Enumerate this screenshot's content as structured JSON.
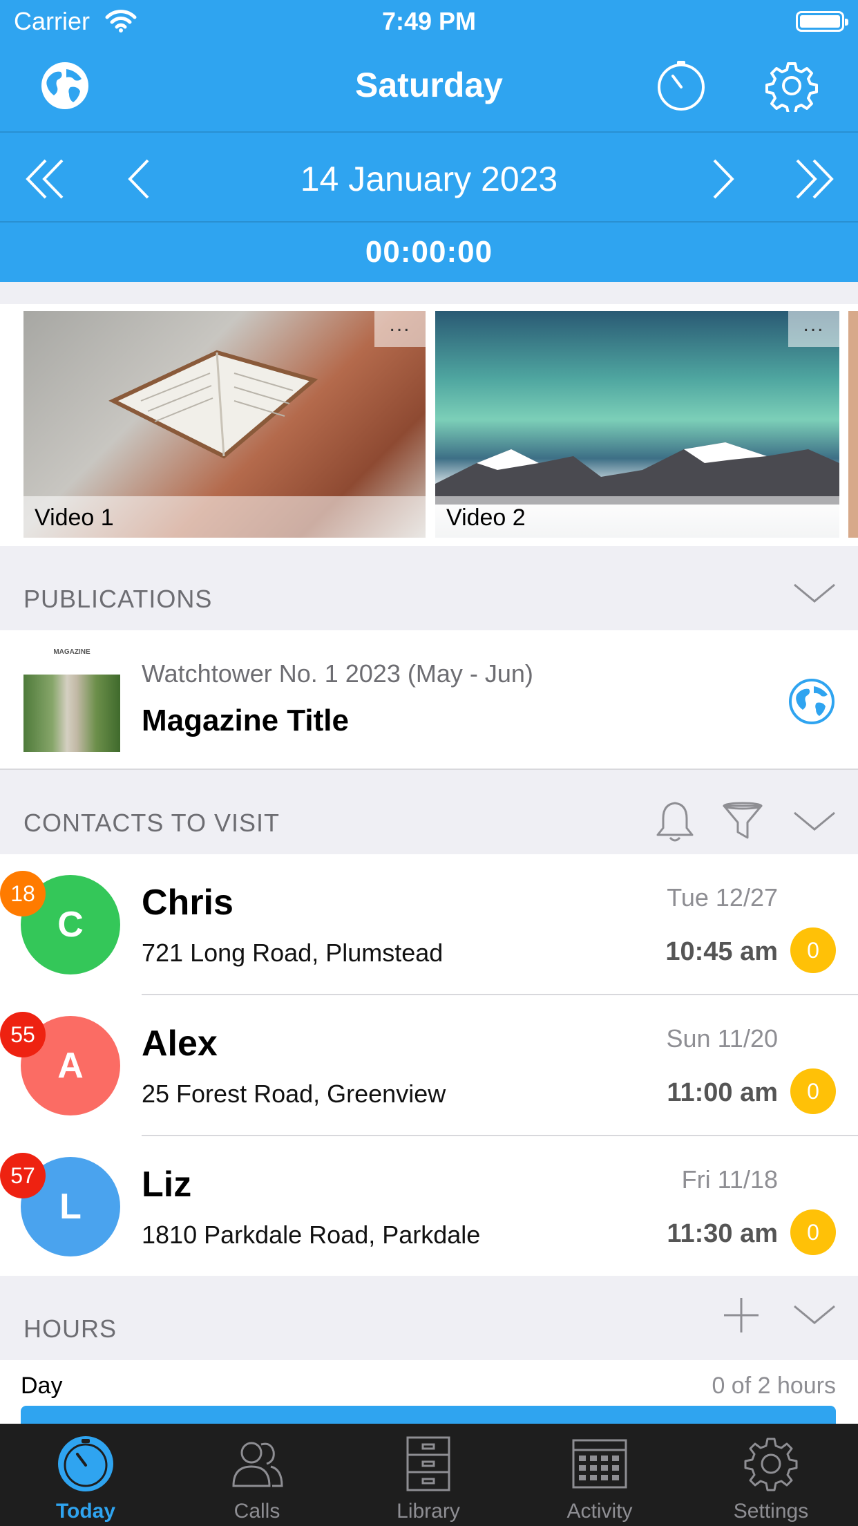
{
  "status_bar": {
    "carrier": "Carrier",
    "time": "7:49 PM"
  },
  "navbar": {
    "title": "Saturday"
  },
  "date_nav": {
    "date": "14 January 2023"
  },
  "timer": "00:00:00",
  "videos": [
    {
      "label": "Video 1",
      "more": "..."
    },
    {
      "label": "Video 2",
      "more": "..."
    }
  ],
  "sections": {
    "publications": "PUBLICATIONS",
    "contacts": "CONTACTS TO VISIT",
    "hours": "HOURS"
  },
  "publication": {
    "masthead": "MAGAZINE",
    "subtitle": "Watchtower No. 1 2023 (May - Jun)",
    "title": "Magazine Title"
  },
  "contacts": [
    {
      "initial": "C",
      "name": "Chris",
      "address": "721 Long Road, Plumstead",
      "date": "Tue 12/27",
      "time": "10:45 am",
      "badge_top": "18",
      "badge_bottom": "0",
      "avatar_color": "#34c759",
      "badge_top_color": "#ff7b00"
    },
    {
      "initial": "A",
      "name": "Alex",
      "address": "25 Forest Road, Greenview",
      "date": "Sun 11/20",
      "time": "11:00 am",
      "badge_top": "55",
      "badge_bottom": "0",
      "avatar_color": "#fb6c64",
      "badge_top_color": "#ee2211"
    },
    {
      "initial": "L",
      "name": "Liz",
      "address": "1810 Parkdale Road, Parkdale",
      "date": "Fri 11/18",
      "time": "11:30 am",
      "badge_top": "57",
      "badge_bottom": "0",
      "avatar_color": "#4aa3ee",
      "badge_top_color": "#ee2211"
    }
  ],
  "hours": {
    "label": "Day",
    "progress_text": "0 of 2 hours"
  },
  "tabs": [
    {
      "label": "Today",
      "icon": "stopwatch-icon",
      "active": true
    },
    {
      "label": "Calls",
      "icon": "people-icon",
      "active": false
    },
    {
      "label": "Library",
      "icon": "cabinet-icon",
      "active": false
    },
    {
      "label": "Activity",
      "icon": "calendar-icon",
      "active": false
    },
    {
      "label": "Settings",
      "icon": "gear-icon",
      "active": false
    }
  ],
  "colors": {
    "accent": "#2fa4f0",
    "badge_yellow": "#ffc107",
    "tabbar": "#1e1e1e"
  }
}
